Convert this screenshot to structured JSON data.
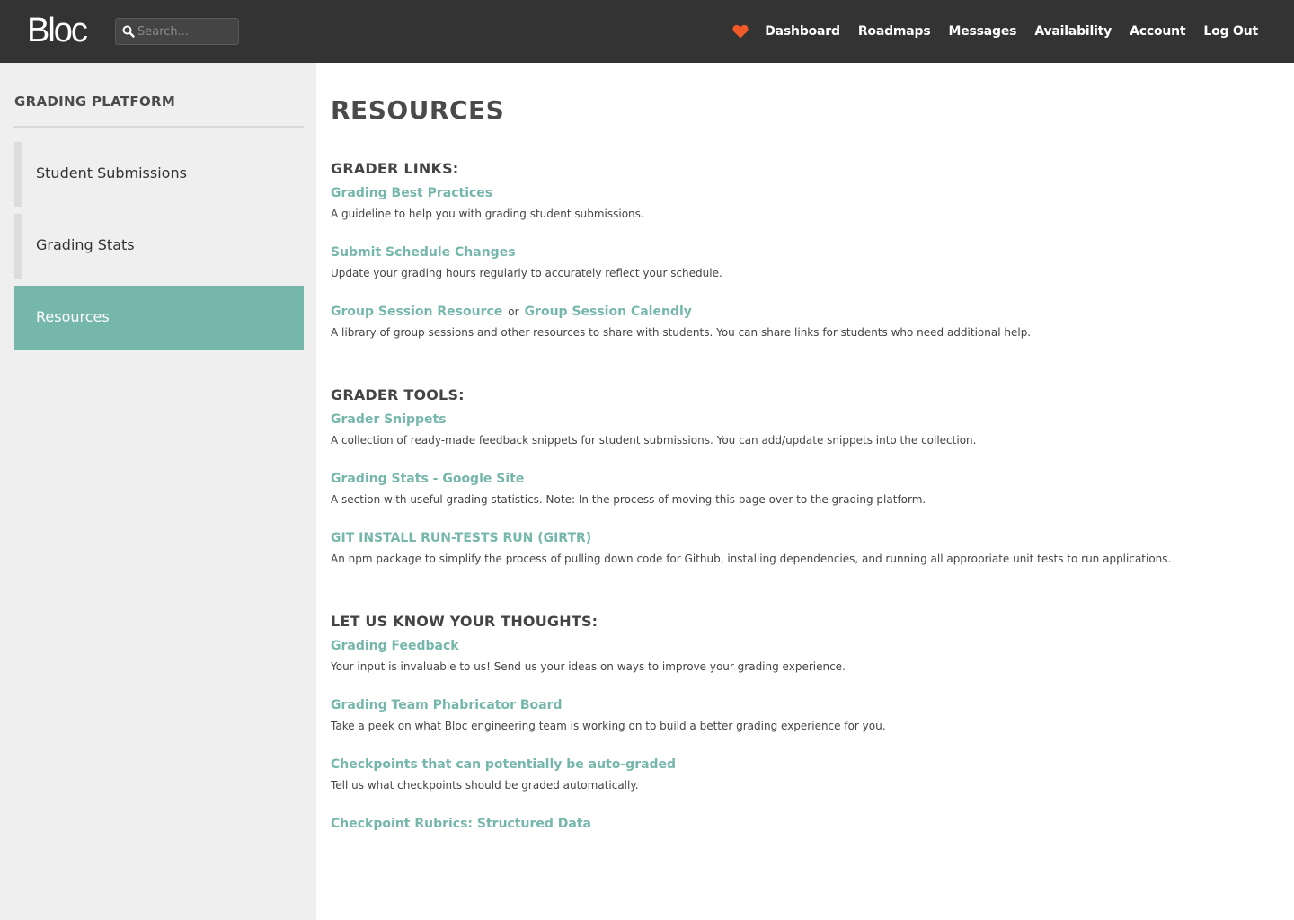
{
  "header": {
    "logo": "Bloc",
    "search_placeholder": "Search...",
    "nav": [
      "Dashboard",
      "Roadmaps",
      "Messages",
      "Availability",
      "Account",
      "Log Out"
    ],
    "heart_color": "#f05a28"
  },
  "sidebar": {
    "title": "GRADING PLATFORM",
    "items": [
      {
        "label": "Student Submissions",
        "active": false
      },
      {
        "label": "Grading Stats",
        "active": false
      },
      {
        "label": "Resources",
        "active": true
      }
    ]
  },
  "main": {
    "title": "RESOURCES",
    "sections": [
      {
        "title": "GRADER LINKS:",
        "items": [
          {
            "link": "Grading Best Practices",
            "desc": "A guideline to help you with grading student submissions."
          },
          {
            "link": "Submit Schedule Changes",
            "desc": "Update your grading hours regularly to accurately reflect your schedule."
          },
          {
            "link": "Group Session Resource",
            "or": "or",
            "link2": "Group Session Calendly",
            "desc": "A library of group sessions and other resources to share with students. You can share links for students who need additional help."
          }
        ]
      },
      {
        "title": "GRADER TOOLS:",
        "items": [
          {
            "link": "Grader Snippets",
            "desc": "A collection of ready-made feedback snippets for student submissions. You can add/update snippets into the collection."
          },
          {
            "link": "Grading Stats - Google Site",
            "desc": "A section with useful grading statistics. Note: In the process of moving this page over to the grading platform."
          },
          {
            "link": "GIT INSTALL RUN-TESTS RUN (GIRTR)",
            "desc": "An npm package to simplify the process of pulling down code for Github, installing dependencies, and running all appropriate unit tests to run applications."
          }
        ]
      },
      {
        "title": "LET US KNOW YOUR THOUGHTS:",
        "items": [
          {
            "link": "Grading Feedback",
            "desc": "Your input is invaluable to us! Send us your ideas on ways to improve your grading experience."
          },
          {
            "link": "Grading Team Phabricator Board",
            "desc": "Take a peek on what Bloc engineering team is working on to build a better grading experience for you."
          },
          {
            "link": "Checkpoints that can potentially be auto-graded",
            "desc": "Tell us what checkpoints should be graded automatically."
          },
          {
            "link": "Checkpoint Rubrics: Structured Data"
          }
        ]
      }
    ]
  },
  "colors": {
    "accent": "#76b7ab",
    "topbar": "#333333",
    "sidebar_bg": "#efefef"
  }
}
